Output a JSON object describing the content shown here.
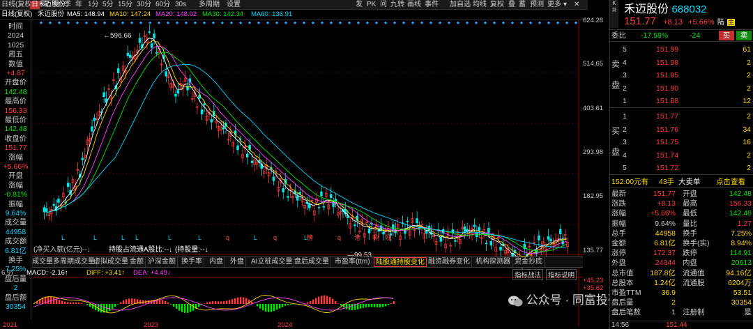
{
  "toolbar": {
    "items": [
      "日线(复权)",
      "禾迈股份",
      "日",
      "周",
      "月",
      "季",
      "年",
      "1分",
      "5分",
      "15分",
      "30分",
      "60分",
      "30s",
      "多周期",
      "设置"
    ],
    "right_tools": [
      "发",
      "PK",
      "问",
      "九转",
      "画线",
      "事件",
      "加自选",
      "均线",
      "复权",
      "叠",
      "蓄",
      "预测",
      "更多"
    ]
  },
  "ma_line": {
    "ma5_label": "MA5: 148.94",
    "ma10_label": "MA10: 147.24",
    "ma20_label": "MA20: 148.02",
    "ma30_label": "MA30: 142.34",
    "ma60_label": "MA60: 136.91"
  },
  "left_info": [
    {
      "label": "时间",
      "color": "#c8c8c8"
    },
    {
      "label": "2024",
      "color": "#c8c8c8"
    },
    {
      "label": "1025",
      "color": "#c8c8c8"
    },
    {
      "label": "周五",
      "color": "#c8c8c8"
    },
    {
      "label": "数值",
      "color": "#c8c8c8"
    },
    {
      "label": "+4.87",
      "color": "#ff3c3c"
    },
    {
      "label": "开盘价",
      "color": "#c8c8c8"
    },
    {
      "label": "142.48",
      "color": "#00e600"
    },
    {
      "label": "最高价",
      "color": "#c8c8c8"
    },
    {
      "label": "156.33",
      "color": "#ff3c3c"
    },
    {
      "label": "最低价",
      "color": "#c8c8c8"
    },
    {
      "label": "142.48",
      "color": "#00e600"
    },
    {
      "label": "收盘价",
      "color": "#c8c8c8"
    },
    {
      "label": "151.77",
      "color": "#ff3c3c"
    },
    {
      "label": "涨幅",
      "color": "#c8c8c8"
    },
    {
      "label": "+5.66%",
      "color": "#ff3c3c"
    },
    {
      "label": "开盘",
      "color": "#c8c8c8"
    },
    {
      "label": "涨幅",
      "color": "#c8c8c8"
    },
    {
      "label": "-0.81%",
      "color": "#00e600"
    },
    {
      "label": "振幅",
      "color": "#c8c8c8"
    },
    {
      "label": "9.64%",
      "color": "#00d8ff"
    },
    {
      "label": "成交量",
      "color": "#c8c8c8"
    },
    {
      "label": "44958",
      "color": "#00d8ff"
    },
    {
      "label": "成交额",
      "color": "#c8c8c8"
    },
    {
      "label": "6.81亿",
      "color": "#00d8ff"
    },
    {
      "label": "换手",
      "color": "#c8c8c8"
    },
    {
      "label": "7.25%",
      "color": "#00d8ff"
    },
    {
      "label": "盘后量",
      "color": "#c8c8c8"
    },
    {
      "label": "2",
      "color": "#00d8ff"
    },
    {
      "label": "盘后额",
      "color": "#c8c8c8"
    },
    {
      "label": "30354",
      "color": "#00d8ff"
    }
  ],
  "chart_data": {
    "type": "candlestick",
    "price_axis_labels": [
      "624.28",
      "514.65",
      "403.61",
      "293.98",
      "182.95"
    ],
    "price_axis_bottom": "135.77",
    "high_marker": "596.66",
    "low_marker": "99.53",
    "x_labels": [
      "2021",
      "2023",
      "2024"
    ],
    "macd_label": "MACD: -2.16↑",
    "diff_label": "DIFF: +3.41↑",
    "dea_label": "DEA: +4.49↓",
    "macd_params": "6,9)",
    "macd_axis": [
      "+45.23",
      "+35.62"
    ],
    "close_series": [
      210,
      230,
      260,
      300,
      380,
      430,
      470,
      500,
      540,
      560,
      596,
      570,
      520,
      470,
      500,
      460,
      430,
      410,
      390,
      370,
      350,
      330,
      310,
      300,
      270,
      250,
      240,
      220,
      230,
      240,
      220,
      200,
      185,
      175,
      170,
      165,
      168,
      175,
      185,
      172,
      160,
      155,
      150,
      165,
      170,
      160,
      150,
      140,
      120,
      110,
      125,
      135,
      140,
      150,
      152
    ]
  },
  "annotation_markers": [
    "L",
    "L",
    "L",
    "L",
    "L",
    "L",
    "q",
    "L",
    "q",
    "L",
    "榜",
    "q",
    "港",
    "财",
    "涨"
  ],
  "holding_row": {
    "col1": "(净买入额(亿元)--↓",
    "col2": "持股占流通A股比:--↓",
    "col3": "(持股量:--↓"
  },
  "tabs": [
    "成交量",
    "多周期成交量",
    "虚拟成交量",
    "金额",
    "沪深金额",
    "换手率",
    "内盘",
    "外盘",
    "AI立桩成交量",
    "盘后成交量",
    "市盈率(ttm)",
    "陆股通持股变化",
    "融资融券变化",
    "机构探测器",
    "资金抄底"
  ],
  "active_tab": "陆股通持股变化",
  "macd_buttons": {
    "strategy": "指标战法",
    "desc": "指标说明"
  },
  "watermark": "公众号 · 同富投研营",
  "stock": {
    "name": "禾迈股份",
    "code": "688032",
    "price": "151.77",
    "change": "+8.13",
    "pct": "+5.66%",
    "badge": "陆",
    "badge2": "主",
    "weibi_label": "委比",
    "weibi": "-17.58%",
    "weicha": "-24",
    "buy_btn": "买",
    "sell_btn": "卖"
  },
  "ask": [
    {
      "lvl": "5",
      "price": "151.99",
      "vol": "61"
    },
    {
      "lvl": "4",
      "price": "151.98",
      "vol": "2"
    },
    {
      "lvl": "3",
      "price": "151.95",
      "vol": "2"
    },
    {
      "lvl": "2",
      "price": "151.90",
      "vol": "2"
    },
    {
      "lvl": "1",
      "price": "151.88",
      "vol": "12"
    }
  ],
  "ask_side_label": [
    "卖",
    "盘"
  ],
  "bid": [
    {
      "lvl": "1",
      "price": "151.77",
      "vol": "2"
    },
    {
      "lvl": "2",
      "price": "151.76",
      "vol": "34"
    },
    {
      "lvl": "3",
      "price": "151.75",
      "vol": "16"
    },
    {
      "lvl": "4",
      "price": "151.74",
      "vol": "2"
    },
    {
      "lvl": "5",
      "price": "151.72",
      "vol": "2"
    }
  ],
  "bid_side_label": [
    "买",
    "盘"
  ],
  "big_order": {
    "price": "152.00元有",
    "qty": "43手",
    "label": "大卖单",
    "link": "点击查看"
  },
  "stats": [
    {
      "l1": "最新",
      "v1": "151.77",
      "c1": "#ff3c3c",
      "l2": "开盘",
      "v2": "142.48",
      "c2": "#00e600"
    },
    {
      "l1": "涨跌",
      "v1": "+8.13",
      "c1": "#ff3c3c",
      "l2": "最高",
      "v2": "156.33",
      "c2": "#ff3c3c"
    },
    {
      "l1": "涨幅",
      "v1": "+5.66%",
      "c1": "#ff3c3c",
      "l2": "最低",
      "v2": "142.48",
      "c2": "#00e600"
    },
    {
      "l1": "振幅",
      "v1": "9.64%",
      "c1": "#c8c8c8",
      "l2": "量比",
      "v2": "1.27",
      "c2": "#ff3c3c"
    },
    {
      "l1": "总手",
      "v1": "44958",
      "c1": "#ffd800",
      "l2": "换手",
      "v2": "7.25%",
      "c2": "#ffd800"
    },
    {
      "l1": "金额",
      "v1": "6.81亿",
      "c1": "#ffd800",
      "l2": "换手(实)",
      "v2": "8.94%",
      "c2": "#ffd800"
    },
    {
      "l1": "涨停",
      "v1": "172.37",
      "c1": "#ff3c3c",
      "l2": "跌停",
      "v2": "114.91",
      "c2": "#00e600"
    },
    {
      "l1": "外盘",
      "v1": "24344",
      "c1": "#ff3c3c",
      "l2": "内盘",
      "v2": "20613",
      "c2": "#00e600"
    },
    {
      "l1": "总市值",
      "v1": "187.8亿",
      "c1": "#ffd800",
      "l2": "流通值",
      "v2": "94.16亿",
      "c2": "#ffd800"
    },
    {
      "l1": "总股本",
      "v1": "1.24亿",
      "c1": "#ffd800",
      "l2": "流通股",
      "v2": "6204万",
      "c2": "#ffd800"
    },
    {
      "l1": "市盈TTM",
      "v1": "36.9",
      "c1": "#ffd800",
      "l2": "",
      "v2": "53.51",
      "c2": "#ffd800"
    },
    {
      "l1": "盘后量",
      "v1": "2",
      "c1": "#ffd800",
      "l2": "",
      "v2": "30354",
      "c2": "#ffd800"
    },
    {
      "l1": "盘后笔数",
      "v1": "1",
      "c1": "#c8c8c8",
      "l2": "注册制",
      "v2": "是",
      "c2": "#c8c8c8"
    }
  ],
  "bottom_row": {
    "time": "14:56",
    "price": "151.44"
  },
  "colors": {
    "up": "#ff3c3c",
    "down": "#00e600",
    "bg": "#000000",
    "grid": "#3a0000"
  }
}
